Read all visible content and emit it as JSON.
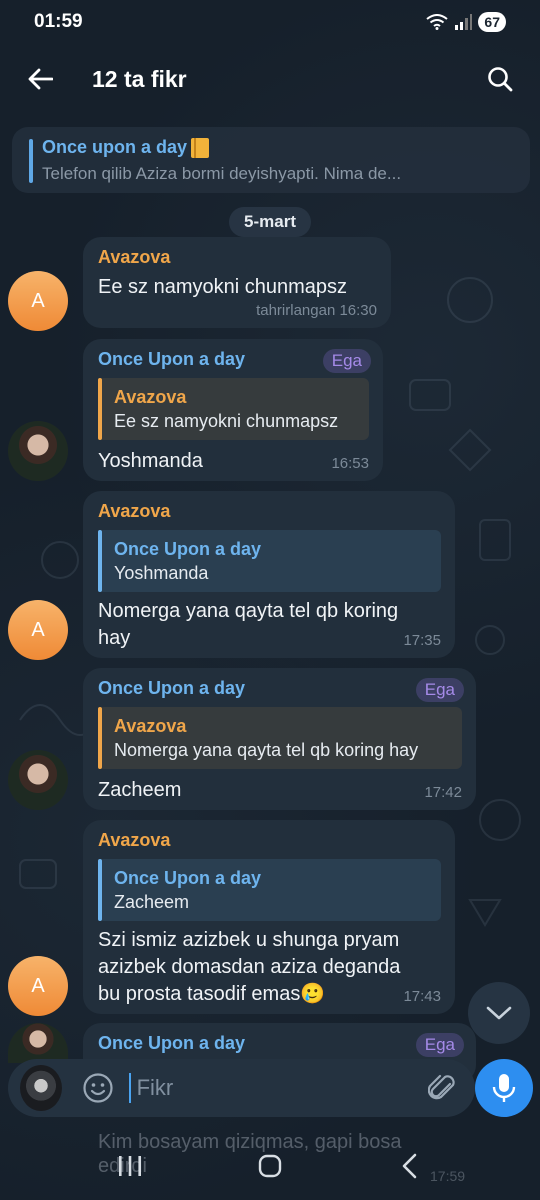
{
  "status": {
    "time": "01:59",
    "battery": "67"
  },
  "header": {
    "title": "12 ta fikr"
  },
  "pinned": {
    "title": "Once upon a day",
    "text": "Telefon qilib Aziza bormi deyishyapti. Nima de..."
  },
  "date_chip": "5-mart",
  "messages": [
    {
      "sender": "Avazova",
      "text": "Ee sz namyokni chunmapsz",
      "meta": "tahrirlangan 16:30",
      "avatar_letter": "A"
    },
    {
      "sender": "Once Upon a day",
      "badge": "Ega",
      "reply_name": "Avazova",
      "reply_text": "Ee sz namyokni chunmapsz",
      "text": "Yoshmanda",
      "meta": "16:53"
    },
    {
      "sender": "Avazova",
      "reply_name": "Once Upon a day",
      "reply_text": "Yoshmanda",
      "text_line1": "Nomerga yana qayta tel qb koring",
      "text_line2": "hay",
      "meta": "17:35",
      "avatar_letter": "A"
    },
    {
      "sender": "Once Upon a day",
      "badge": "Ega",
      "reply_name": "Avazova",
      "reply_text": "Nomerga yana qayta tel qb koring hay",
      "text": "Zacheem",
      "meta": "17:42"
    },
    {
      "sender": "Avazova",
      "reply_name": "Once Upon a day",
      "reply_text": "Zacheem",
      "text_line1": "Szi ismiz azizbek u shunga pryam",
      "text_line2": "azizbek domasdan aziza deganda",
      "text_line3": "bu prosta tasodif emas",
      "emoji": "🥲",
      "meta": "17:43",
      "avatar_letter": "A"
    },
    {
      "sender": "Once Upon a day",
      "badge": "Ega"
    }
  ],
  "ghost": {
    "line1": "Kim bosayam qiziqmas, gapi bosa",
    "line2": "edirdi",
    "time": "17:59"
  },
  "input": {
    "placeholder": "Fikr"
  },
  "colors": {
    "accent": "#2d8ef0",
    "sender_orange": "#f0a64a",
    "sender_blue": "#6eb4ee",
    "badge": "#a58ae8"
  },
  "icons": [
    "back-arrow-icon",
    "search-icon",
    "notebook-icon",
    "chevron-down-icon",
    "emoji-icon",
    "attach-icon",
    "mic-icon",
    "recents-icon",
    "home-icon",
    "back-nav-icon"
  ]
}
